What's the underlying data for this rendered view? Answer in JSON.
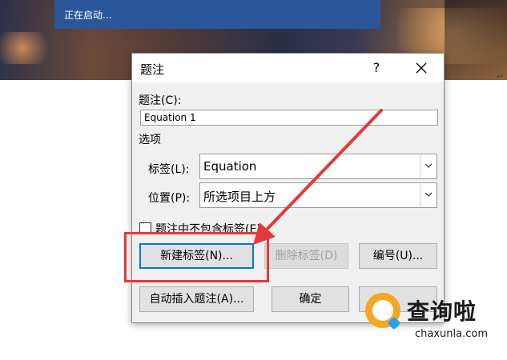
{
  "startup_banner": {
    "text": "正在启动..."
  },
  "document": {
    "paragraph_mark": "↵"
  },
  "dialog": {
    "title": "题注",
    "help_glyph": "?",
    "caption_label": "题注(C):",
    "caption_label_key": "C",
    "caption_value": "Equation 1",
    "options_heading": "选项",
    "label_field": {
      "label": "标签(L):",
      "value": "Equation"
    },
    "position_field": {
      "label": "位置(P):",
      "value": "所选项目上方"
    },
    "exclude_label_checkbox": {
      "label": "题注中不包含标签(E)",
      "checked": false
    },
    "buttons": {
      "new_label": "新建标签(N)...",
      "delete_label": "删除标签(D)",
      "numbering": "编号(U)...",
      "auto_caption": "自动插入题注(A)...",
      "ok": "确定"
    }
  },
  "annotation": {
    "highlight_color": "#e23a3a"
  },
  "watermark": {
    "brand_cn": "查询啦",
    "brand_en": "chaxunla.com",
    "accent": "#f5a623",
    "accent2": "#2a9df4"
  }
}
